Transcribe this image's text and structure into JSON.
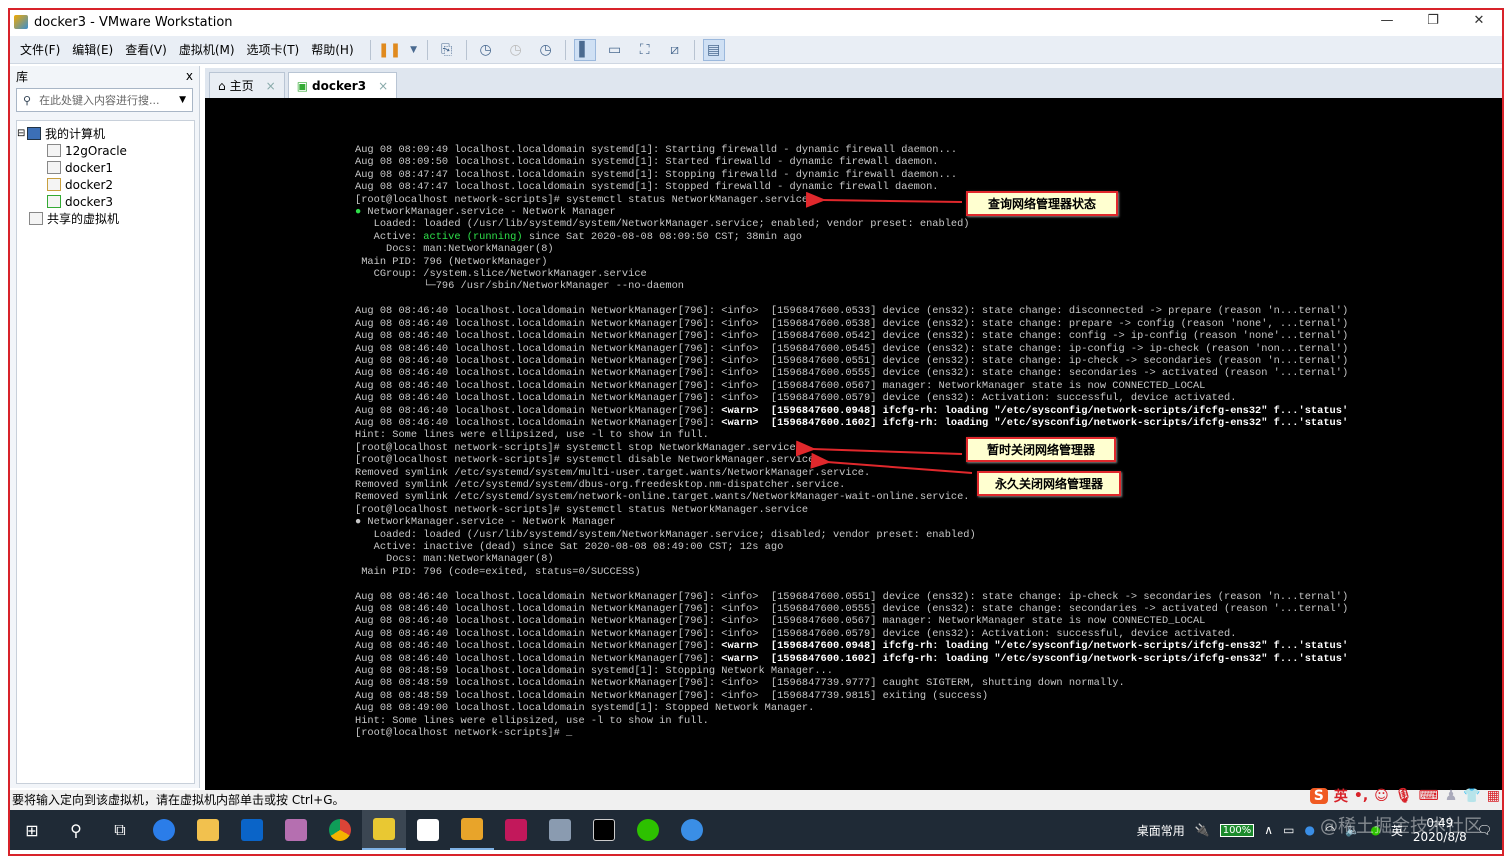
{
  "window": {
    "title": "docker3 - VMware Workstation",
    "minimize": "—",
    "restore": "❐",
    "close": "✕"
  },
  "menu": [
    "文件(F)",
    "编辑(E)",
    "查看(V)",
    "虚拟机(M)",
    "选项卡(T)",
    "帮助(H)"
  ],
  "library": {
    "title": "库",
    "close": "x",
    "search_placeholder": "在此处键入内容进行搜...",
    "tree": {
      "root": "我的计算机",
      "vms": [
        "12gOracle",
        "docker1",
        "docker2",
        "docker3"
      ],
      "shared": "共享的虚拟机"
    }
  },
  "tabs": [
    {
      "label": "主页"
    },
    {
      "label": "docker3"
    }
  ],
  "terminal": {
    "lines": [
      "Aug 08 08:09:49 localhost.localdomain systemd[1]: Starting firewalld - dynamic firewall daemon...",
      "Aug 08 08:09:50 localhost.localdomain systemd[1]: Started firewalld - dynamic firewall daemon.",
      "Aug 08 08:47:47 localhost.localdomain systemd[1]: Stopping firewalld - dynamic firewall daemon...",
      "Aug 08 08:47:47 localhost.localdomain systemd[1]: Stopped firewalld - dynamic firewall daemon.",
      "[root@localhost network-scripts]# systemctl status NetworkManager.service",
      "● NetworkManager.service - Network Manager",
      "   Loaded: loaded (/usr/lib/systemd/system/NetworkManager.service; enabled; vendor preset: enabled)",
      "   Active: active (running) since Sat 2020-08-08 08:09:50 CST; 38min ago",
      "     Docs: man:NetworkManager(8)",
      " Main PID: 796 (NetworkManager)",
      "   CGroup: /system.slice/NetworkManager.service",
      "           └─796 /usr/sbin/NetworkManager --no-daemon",
      "",
      "Aug 08 08:46:40 localhost.localdomain NetworkManager[796]: <info>  [1596847600.0533] device (ens32): state change: disconnected -> prepare (reason 'n...ternal')",
      "Aug 08 08:46:40 localhost.localdomain NetworkManager[796]: <info>  [1596847600.0538] device (ens32): state change: prepare -> config (reason 'none', ...ternal')",
      "Aug 08 08:46:40 localhost.localdomain NetworkManager[796]: <info>  [1596847600.0542] device (ens32): state change: config -> ip-config (reason 'none'...ternal')",
      "Aug 08 08:46:40 localhost.localdomain NetworkManager[796]: <info>  [1596847600.0545] device (ens32): state change: ip-config -> ip-check (reason 'non...ternal')",
      "Aug 08 08:46:40 localhost.localdomain NetworkManager[796]: <info>  [1596847600.0551] device (ens32): state change: ip-check -> secondaries (reason 'n...ternal')",
      "Aug 08 08:46:40 localhost.localdomain NetworkManager[796]: <info>  [1596847600.0555] device (ens32): state change: secondaries -> activated (reason '...ternal')",
      "Aug 08 08:46:40 localhost.localdomain NetworkManager[796]: <info>  [1596847600.0567] manager: NetworkManager state is now CONNECTED_LOCAL",
      "Aug 08 08:46:40 localhost.localdomain NetworkManager[796]: <info>  [1596847600.0579] device (ens32): Activation: successful, device activated.",
      "Aug 08 08:46:40 localhost.localdomain NetworkManager[796]: <warn>  [1596847600.0948] ifcfg-rh: loading \"/etc/sysconfig/network-scripts/ifcfg-ens32\" f...'status'",
      "Aug 08 08:46:40 localhost.localdomain NetworkManager[796]: <warn>  [1596847600.1602] ifcfg-rh: loading \"/etc/sysconfig/network-scripts/ifcfg-ens32\" f...'status'",
      "Hint: Some lines were ellipsized, use -l to show in full.",
      "[root@localhost network-scripts]# systemctl stop NetworkManager.service",
      "[root@localhost network-scripts]# systemctl disable NetworkManager.service",
      "Removed symlink /etc/systemd/system/multi-user.target.wants/NetworkManager.service.",
      "Removed symlink /etc/systemd/system/dbus-org.freedesktop.nm-dispatcher.service.",
      "Removed symlink /etc/systemd/system/network-online.target.wants/NetworkManager-wait-online.service.",
      "[root@localhost network-scripts]# systemctl status NetworkManager.service",
      "● NetworkManager.service - Network Manager",
      "   Loaded: loaded (/usr/lib/systemd/system/NetworkManager.service; disabled; vendor preset: enabled)",
      "   Active: inactive (dead) since Sat 2020-08-08 08:49:00 CST; 12s ago",
      "     Docs: man:NetworkManager(8)",
      " Main PID: 796 (code=exited, status=0/SUCCESS)",
      "",
      "Aug 08 08:46:40 localhost.localdomain NetworkManager[796]: <info>  [1596847600.0551] device (ens32): state change: ip-check -> secondaries (reason 'n...ternal')",
      "Aug 08 08:46:40 localhost.localdomain NetworkManager[796]: <info>  [1596847600.0555] device (ens32): state change: secondaries -> activated (reason '...ternal')",
      "Aug 08 08:46:40 localhost.localdomain NetworkManager[796]: <info>  [1596847600.0567] manager: NetworkManager state is now CONNECTED_LOCAL",
      "Aug 08 08:46:40 localhost.localdomain NetworkManager[796]: <info>  [1596847600.0579] device (ens32): Activation: successful, device activated.",
      "Aug 08 08:46:40 localhost.localdomain NetworkManager[796]: <warn>  [1596847600.0948] ifcfg-rh: loading \"/etc/sysconfig/network-scripts/ifcfg-ens32\" f...'status'",
      "Aug 08 08:46:40 localhost.localdomain NetworkManager[796]: <warn>  [1596847600.1602] ifcfg-rh: loading \"/etc/sysconfig/network-scripts/ifcfg-ens32\" f...'status'",
      "Aug 08 08:48:59 localhost.localdomain systemd[1]: Stopping Network Manager...",
      "Aug 08 08:48:59 localhost.localdomain NetworkManager[796]: <info>  [1596847739.9777] caught SIGTERM, shutting down normally.",
      "Aug 08 08:48:59 localhost.localdomain NetworkManager[796]: <info>  [1596847739.9815] exiting (success)",
      "Aug 08 08:49:00 localhost.localdomain systemd[1]: Stopped Network Manager.",
      "Hint: Some lines were ellipsized, use -l to show in full.",
      "[root@localhost network-scripts]# _"
    ],
    "active_green": "active (running)"
  },
  "annotations": [
    "查询网络管理器状态",
    "暂时关闭网络管理器",
    "永久关闭网络管理器"
  ],
  "statusbar": {
    "text": "要将输入定向到该虚拟机，请在虚拟机内部单击或按 Ctrl+G。"
  },
  "ime": {
    "lang": "英",
    "logo": "S"
  },
  "taskbar": {
    "toolbar_label": "桌面常用",
    "battery": "100%",
    "ime_lang": "英",
    "time": "0:49",
    "date": "2020/8/8",
    "watermark": "@稀土掘金技术社区"
  },
  "colors": {
    "accent": "#d8232a",
    "console_bg": "#000000",
    "active_green": "#2ee04a"
  }
}
